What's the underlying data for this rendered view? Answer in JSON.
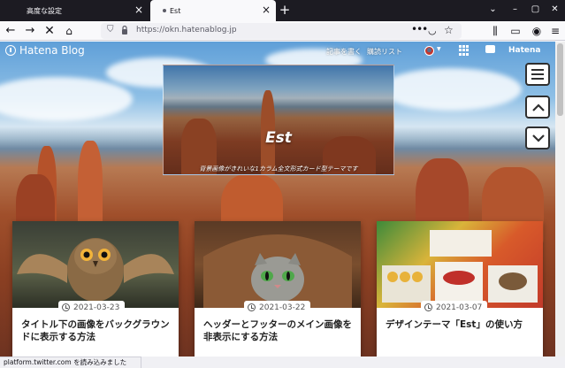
{
  "browser": {
    "tabs": [
      {
        "label": "高度な設定",
        "active": false
      },
      {
        "label": "Est",
        "active": true
      }
    ],
    "url": "https://okn.hatenablog.jp",
    "status": "platform.twitter.com を読み込みました"
  },
  "blog_header": {
    "logo_text": "Hatena Blog",
    "links": {
      "write": "記事を書く",
      "read": "購読リスト"
    },
    "brand": "Hatena"
  },
  "hero": {
    "title": "Est",
    "description": "背景画像がきれいな1カラム全文形式カード型テーマです"
  },
  "articles": [
    {
      "date": "2021-03-23",
      "title": "タイトル下の画像をバックグラウンドに表示する方法",
      "image": "owl-in-flight"
    },
    {
      "date": "2021-03-22",
      "title": "ヘッダーとフッターのメイン画像を非表示にする方法",
      "image": "cat-under-blanket"
    },
    {
      "date": "2021-03-07",
      "title": "デザインテーマ「Est」の使い方",
      "image": "colorful-pasta-collage"
    }
  ],
  "colors": {
    "tab_bar": "#1c1b22",
    "toolbar": "#f9f9fb",
    "sky": "#5f9fd8",
    "canyon": "#a04f2b"
  },
  "icons": [
    "back-icon",
    "forward-icon",
    "stop-icon",
    "home-icon",
    "shield-icon",
    "lock-icon",
    "more-icon",
    "pocket-icon",
    "star-icon",
    "library-icon",
    "sidebar-icon",
    "account-icon",
    "menu-icon",
    "clock-icon"
  ]
}
